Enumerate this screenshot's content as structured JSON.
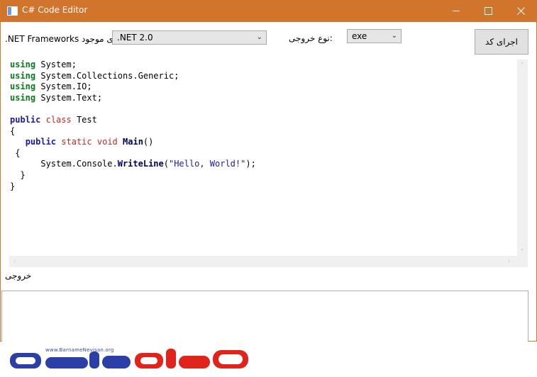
{
  "window": {
    "title": "C# Code Editor"
  },
  "toolbar": {
    "frameworks_label": ".NET Frameworks های موجود",
    "framework_selected": ".NET 2.0",
    "output_type_label": "نوع خروجی:",
    "output_type_selected": "exe",
    "run_button": "اجرای کد"
  },
  "editor": {
    "lines": [
      "using System;",
      "using System.Collections.Generic;",
      "using System.IO;",
      "using System.Text;",
      "",
      "public class Test",
      "{",
      "   public static void Main()",
      " {",
      "      System.Console.WriteLine(\"Hello, World!\");",
      "  }",
      "}"
    ]
  },
  "output": {
    "label": "خروجی",
    "text": ""
  },
  "watermark": {
    "url": "www.BarnameNevisan.org"
  },
  "colors": {
    "titlebar": "#d2752c",
    "keyword_using": "#0b7a1e",
    "keyword_public": "#1a1aa6",
    "keyword_static": "#c62828",
    "logo_blue": "#2b3fa6",
    "logo_red": "#e0241b"
  }
}
